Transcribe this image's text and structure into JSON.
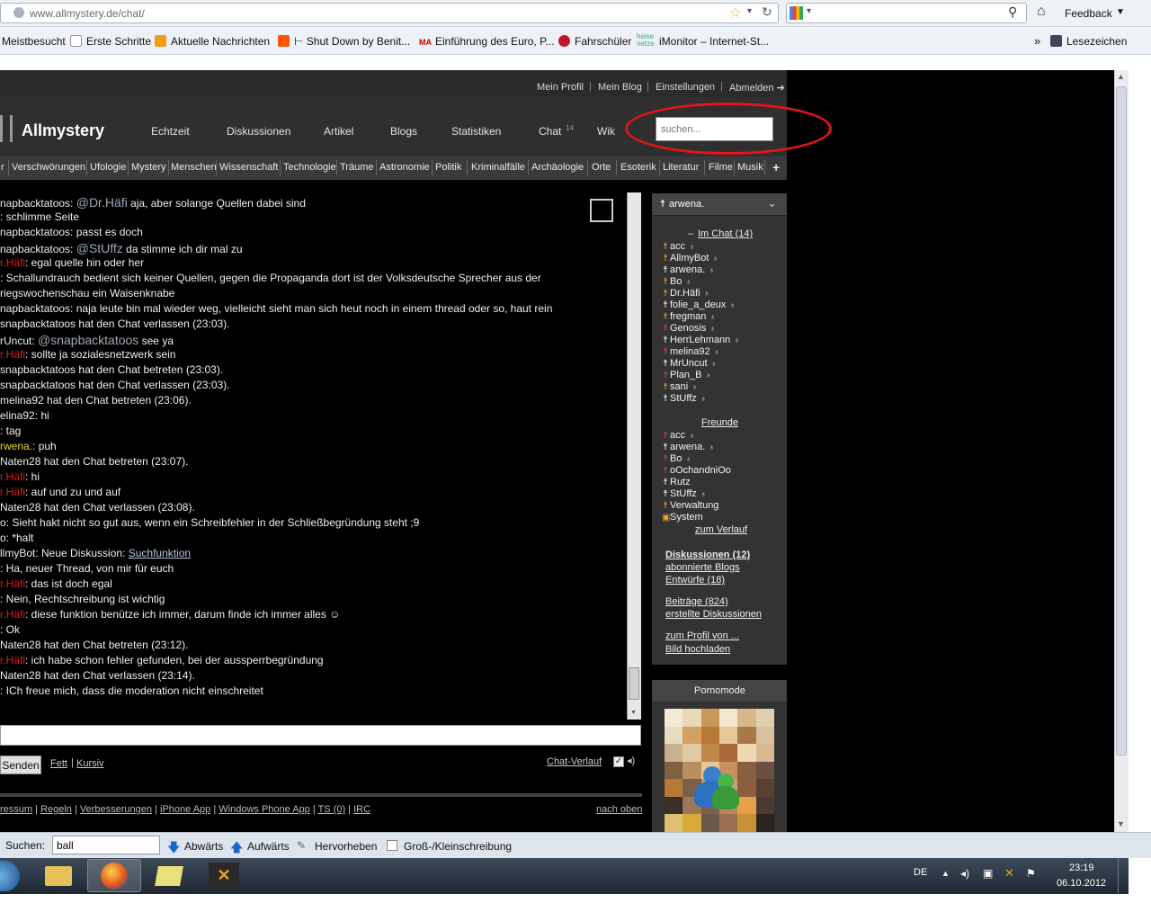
{
  "browser": {
    "url": "www.allmystery.de/chat/",
    "feedback": "Feedback",
    "bookmarks": [
      "Meistbesucht",
      "Erste Schritte",
      "Aktuelle Nachrichten",
      "Shut Down by Benit...",
      "Einführung des Euro, P...",
      "Fahrschüler",
      "iMonitor – Internet-St...",
      "Lesezeichen"
    ],
    "bookmark_more": "»"
  },
  "site": {
    "logo": "Allmystery",
    "toplinks": [
      "Mein Profil",
      "Mein Blog",
      "Einstellungen",
      "Abmelden ➔"
    ],
    "nav": [
      "Echtzeit",
      "Diskussionen",
      "Artikel",
      "Blogs",
      "Statistiken",
      "Chat",
      "Wik"
    ],
    "chat_count": "14",
    "search_placeholder": "suchen...",
    "categories": [
      "r",
      "Verschwörungen",
      "Ufologie",
      "Mystery",
      "Menschen",
      "Wissenschaft",
      "Technologie",
      "Träume",
      "Astronomie",
      "Politik",
      "Kriminalfälle",
      "Archäologie",
      "Orte",
      "Esoterik",
      "Literatur",
      "Filme",
      "Musik",
      "+"
    ]
  },
  "chat": {
    "lines": [
      {
        "parts": [
          {
            "t": "napbacktatoos: ",
            "c": ""
          },
          {
            "t": "@Dr.Häfi",
            "c": "mention"
          },
          {
            "t": " aja, aber solange Quellen dabei sind",
            "c": ""
          }
        ]
      },
      {
        "parts": [
          {
            "t": "      : schlimme Seite",
            "c": ""
          }
        ]
      },
      {
        "parts": [
          {
            "t": "napbacktatoos: passt es doch",
            "c": ""
          }
        ]
      },
      {
        "parts": [
          {
            "t": "napbacktatoos: ",
            "c": ""
          },
          {
            "t": "@StUffz",
            "c": "mention"
          },
          {
            "t": " da stimme ich dir mal zu",
            "c": ""
          }
        ]
      },
      {
        "parts": [
          {
            "t": "r.Häfi",
            "c": "red"
          },
          {
            "t": ": egal quelle hin oder her",
            "c": ""
          }
        ]
      },
      {
        "parts": [
          {
            "t": "      : Schallundrauch bedient sich keiner Quellen, gegen die Propaganda dort ist der Volksdeutsche Sprecher aus der",
            "c": ""
          }
        ]
      },
      {
        "parts": [
          {
            "t": "riegswochenschau ein Waisenknabe",
            "c": ""
          }
        ]
      },
      {
        "parts": [
          {
            "t": "napbacktatoos: naja leute bin mal wieder weg, vielleicht sieht man sich heut noch in einem thread oder so, haut rein",
            "c": ""
          }
        ]
      },
      {
        "parts": [
          {
            "t": "snapbacktatoos hat den Chat verlassen (23:03).",
            "c": ""
          }
        ]
      },
      {
        "parts": [
          {
            "t": "rUncut: ",
            "c": ""
          },
          {
            "t": "@snapbacktatoos",
            "c": "mention"
          },
          {
            "t": " see ya",
            "c": ""
          }
        ]
      },
      {
        "parts": [
          {
            "t": "r.Häfi",
            "c": "red"
          },
          {
            "t": ": sollte ja sozialesnetzwerk sein",
            "c": ""
          }
        ]
      },
      {
        "parts": [
          {
            "t": " snapbacktatoos hat den Chat betreten (23:03).",
            "c": ""
          }
        ]
      },
      {
        "parts": [
          {
            "t": "snapbacktatoos hat den Chat verlassen (23:03).",
            "c": ""
          }
        ]
      },
      {
        "parts": [
          {
            "t": " melina92 hat den Chat betreten (23:06).",
            "c": ""
          }
        ]
      },
      {
        "parts": [
          {
            "t": "elina92: hi",
            "c": ""
          }
        ]
      },
      {
        "parts": [
          {
            "t": "      : tag",
            "c": ""
          }
        ]
      },
      {
        "parts": [
          {
            "t": "rwena.",
            "c": "yel"
          },
          {
            "t": ": puh",
            "c": ""
          }
        ]
      },
      {
        "parts": [
          {
            "t": " Naten28 hat den Chat betreten (23:07).",
            "c": ""
          }
        ]
      },
      {
        "parts": [
          {
            "t": "r.Häfi",
            "c": "red"
          },
          {
            "t": ": hi",
            "c": ""
          }
        ]
      },
      {
        "parts": [
          {
            "t": "r.Häfi",
            "c": "red"
          },
          {
            "t": ": auf und zu und auf",
            "c": ""
          }
        ]
      },
      {
        "parts": [
          {
            "t": "Naten28 hat den Chat verlassen (23:08).",
            "c": ""
          }
        ]
      },
      {
        "parts": [
          {
            "t": "o: Sieht hakt nicht so gut aus, wenn ein Schreibfehler in der Schließbegründung steht ;9",
            "c": ""
          }
        ]
      },
      {
        "parts": [
          {
            "t": "o: *halt",
            "c": ""
          }
        ]
      },
      {
        "parts": [
          {
            "t": "llmyBot: Neue Diskussion: ",
            "c": ""
          },
          {
            "t": "Suchfunktion",
            "c": "link"
          }
        ]
      },
      {
        "parts": [
          {
            "t": "      : Ha, neuer Thread, von mir für euch",
            "c": ""
          }
        ]
      },
      {
        "parts": [
          {
            "t": "r.Häfi",
            "c": "red"
          },
          {
            "t": ": das ist doch egal",
            "c": ""
          }
        ]
      },
      {
        "parts": [
          {
            "t": "      : Nein, Rechtschreibung ist wichtig",
            "c": ""
          }
        ]
      },
      {
        "parts": [
          {
            "t": "r.Häfi",
            "c": "red"
          },
          {
            "t": ": diese funktion benütze ich immer, darum finde ich immer alles ☺",
            "c": ""
          }
        ]
      },
      {
        "parts": [
          {
            "t": "      : Ok",
            "c": ""
          }
        ]
      },
      {
        "parts": [
          {
            "t": " Naten28 hat den Chat betreten (23:12).",
            "c": ""
          }
        ]
      },
      {
        "parts": [
          {
            "t": "r.Häfi",
            "c": "red"
          },
          {
            "t": ": ich habe schon fehler gefunden, bei der aussperrbegründung",
            "c": ""
          }
        ]
      },
      {
        "parts": [
          {
            "t": "Naten28 hat den Chat verlassen (23:14).",
            "c": ""
          }
        ]
      },
      {
        "parts": [
          {
            "t": "      : ICh freue mich, dass die moderation nicht einschreitet",
            "c": ""
          }
        ]
      }
    ],
    "send": "Senden",
    "fett": "Fett",
    "kursiv": "Kursiv",
    "verlauf": "Chat-Verlauf",
    "footer_links": [
      "ressum",
      "Regeln",
      "Verbesserungen",
      "iPhone App",
      "Windows Phone App",
      "TS (0)",
      "IRC"
    ],
    "nach_oben": "nach oben"
  },
  "sidebar": {
    "user": "arwena.",
    "im_chat": "Im Chat (14)",
    "users": [
      {
        "name": "acc",
        "g": "s"
      },
      {
        "name": "AllmyBot",
        "g": "s"
      },
      {
        "name": "arwena.",
        "g": "w"
      },
      {
        "name": "Bo",
        "g": "s"
      },
      {
        "name": "Dr.Häfi",
        "g": "s"
      },
      {
        "name": "folie_a_deux",
        "g": "w"
      },
      {
        "name": "fregman",
        "g": "s"
      },
      {
        "name": "Genosis",
        "g": "f"
      },
      {
        "name": "HerrLehmann",
        "g": "w"
      },
      {
        "name": "melina92",
        "g": "f"
      },
      {
        "name": "MrUncut",
        "g": "w"
      },
      {
        "name": "Plan_B",
        "g": "f"
      },
      {
        "name": "sani",
        "g": "s"
      },
      {
        "name": "StUffz",
        "g": "w"
      }
    ],
    "freunde": "Freunde",
    "friends": [
      {
        "name": "acc",
        "g": "f",
        "bell": true
      },
      {
        "name": "arwena.",
        "g": "w",
        "bell": true
      },
      {
        "name": "Bo",
        "g": "f",
        "bell": true
      },
      {
        "name": "oOchandniOo",
        "g": "f",
        "bell": false
      },
      {
        "name": "Rutz",
        "g": "w",
        "bell": false
      },
      {
        "name": "StUffz",
        "g": "w",
        "bell": true
      },
      {
        "name": "Verwaltung",
        "g": "s",
        "bell": false
      },
      {
        "name": "System",
        "g": "box",
        "bell": false
      }
    ],
    "zum_verlauf": "zum Verlauf",
    "diskussionen": "Diskussionen (12)",
    "abonnierte": "abonnierte Blogs",
    "entwuerfe": "Entwürfe (18)",
    "beitraege": "Beiträge (824)",
    "erstellte": "erstellte Diskussionen",
    "zum_profil": "zum Profil von ...",
    "bild": "Bild hochladen",
    "pornomode": "Pornomode"
  },
  "findbar": {
    "label": "Suchen:",
    "value": "ball",
    "down": "Abwärts",
    "up": "Aufwärts",
    "highlight": "Hervorheben",
    "case": "Groß-/Kleinschreibung"
  },
  "taskbar": {
    "lang": "DE",
    "time": "23:19",
    "date": "06.10.2012"
  }
}
